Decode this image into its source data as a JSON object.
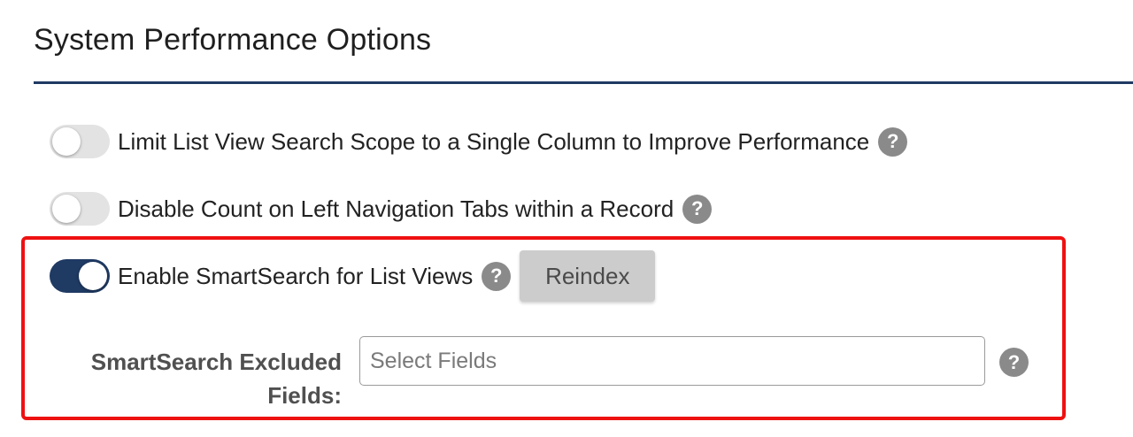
{
  "section": {
    "title": "System Performance Options"
  },
  "options": [
    {
      "label": "Limit List View Search Scope to a Single Column to Improve Performance",
      "enabled": false,
      "help_icon": "question-circle-icon"
    },
    {
      "label": "Disable Count on Left Navigation Tabs within a Record",
      "enabled": false,
      "help_icon": "question-circle-icon"
    },
    {
      "label": "Enable SmartSearch for List Views",
      "enabled": true,
      "help_icon": "question-circle-icon"
    }
  ],
  "reindex": {
    "label": "Reindex"
  },
  "help_glyph": "?",
  "smartsearch_excluded": {
    "label": "SmartSearch Excluded Fields:",
    "placeholder": "Select Fields",
    "value": ""
  },
  "colors": {
    "accent": "#1f3a63",
    "highlight_border": "#ee1111",
    "help_icon": "#8a8a8a",
    "toggle_off": "#e3e3e3"
  }
}
